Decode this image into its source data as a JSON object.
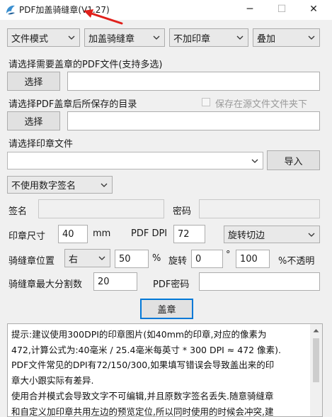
{
  "window": {
    "title": "PDF加盖骑缝章(V1.27)",
    "minimize": "─",
    "maximize": "☐",
    "close": "✕"
  },
  "toolbar": {
    "mode": "文件模式",
    "stamp_type": "加盖骑缝章",
    "stamp_option": "不加印章",
    "overlay": "叠加"
  },
  "pdf_select": {
    "label": "请选择需要盖章的PDF文件(支持多选)",
    "button": "选择",
    "value": ""
  },
  "output_dir": {
    "label": "请选择PDF盖章后所保存的目录",
    "checkbox_label": "保存在源文件文件夹下",
    "button": "选择",
    "value": ""
  },
  "stamp_file": {
    "label": "请选择印章文件",
    "value": "",
    "import_button": "导入"
  },
  "signature": {
    "option": "不使用数字签名",
    "name_label": "签名",
    "name_value": "",
    "password_label": "密码",
    "password_value": ""
  },
  "settings": {
    "stamp_size_label": "印章尺寸",
    "stamp_size_value": "40",
    "stamp_size_unit": "mm",
    "dpi_label": "PDF DPI",
    "dpi_value": "72",
    "rotate_mode": "旋转切边",
    "seam_position_label": "骑缝章位置",
    "seam_position_value": "右",
    "position_percent": "50",
    "percent_sign": "%",
    "rotate_label": "旋转",
    "rotate_value": "0",
    "degree_sign": "°",
    "opacity_value": "100",
    "opacity_label": "%不透明",
    "max_split_label": "骑缝章最大分割数",
    "max_split_value": "20",
    "pdf_password_label": "PDF密码",
    "pdf_password_value": ""
  },
  "action": {
    "stamp_button": "盖章"
  },
  "tips": {
    "line1": "提示:建议使用300DPI的印章图片(如40mm的印章,对应的像素为",
    "line2": "472,计算公式为:40毫米 / 25.4毫米每英寸 * 300 DPI ≈ 472 像素).",
    "line3": "PDF文件常见的DPI有72/150/300,如果填写错误会导致盖出来的印",
    "line4": "章大小跟实际有差异.",
    "line5": "使用合并模式会导致文字不可编辑,并且原数字签名丢失.随意骑缝章",
    "line6": "和自定义加印章共用左边的预览定位,所以同时使用的时候会冲突,建"
  },
  "colors": {
    "accent": "#0078d7",
    "annotation": "#e0201b"
  },
  "icons": {
    "app": "app-logo-icon",
    "arrow": "red-arrow-annotation"
  }
}
